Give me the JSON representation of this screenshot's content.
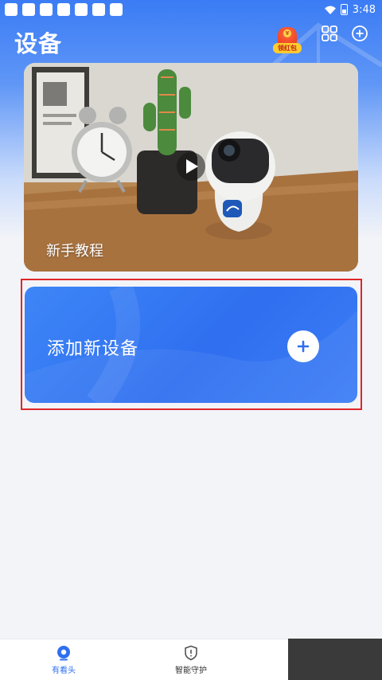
{
  "status_bar": {
    "time": "3:48"
  },
  "header": {
    "title": "设备",
    "redpack_label": "领红包",
    "redpack_coin": "¥"
  },
  "icons": {
    "grid": "grid-icon",
    "add": "add-circle-icon",
    "play": "play-icon",
    "plus": "plus-icon",
    "camera_tab": "camera-tab-icon",
    "shield_tab": "shield-tab-icon"
  },
  "tutorial": {
    "label": "新手教程"
  },
  "add_device": {
    "label": "添加新设备"
  },
  "bottom_nav": {
    "items": [
      {
        "label": "有看头",
        "active": true
      },
      {
        "label": "智能守护",
        "active": false
      }
    ]
  },
  "colors": {
    "accent": "#2f6ff0",
    "highlight": "#e0262a"
  }
}
